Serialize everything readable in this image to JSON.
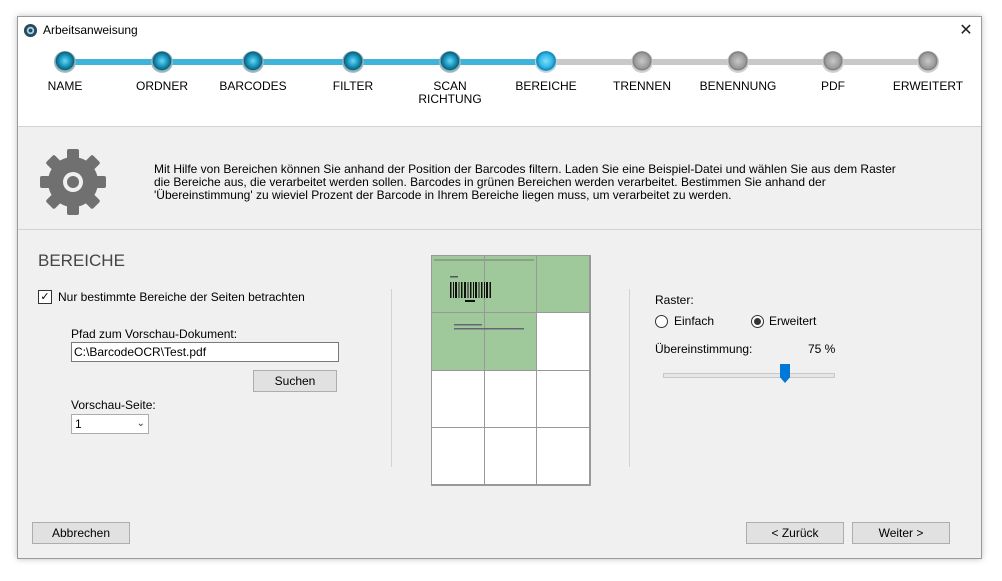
{
  "window": {
    "title": "Arbeitsanweisung",
    "close_icon": "close-icon"
  },
  "steps": [
    {
      "label": "NAME",
      "state": "done"
    },
    {
      "label": "ORDNER",
      "state": "done"
    },
    {
      "label": "BARCODES",
      "state": "done"
    },
    {
      "label": "FILTER",
      "state": "done"
    },
    {
      "label": "SCAN\nRICHTUNG",
      "state": "done"
    },
    {
      "label": "BEREICHE",
      "state": "current"
    },
    {
      "label": "TRENNEN",
      "state": "todo"
    },
    {
      "label": "BENENNUNG",
      "state": "todo"
    },
    {
      "label": "PDF",
      "state": "todo"
    },
    {
      "label": "ERWEITERT",
      "state": "todo"
    }
  ],
  "info": {
    "icon": "gear-icon",
    "text": "Mit Hilfe von Bereichen können Sie anhand der Position der Barcodes filtern. Laden Sie eine Beispiel-Datei und wählen Sie aus dem Raster die Bereiche aus, die verarbeitet werden sollen. Barcodes in grünen Bereichen werden verarbeitet. Bestimmen Sie anhand der 'Übereinstimmung' zu wieviel Prozent der Barcode in Ihrem Bereiche liegen muss, um verarbeitet zu werden."
  },
  "section": {
    "title": "BEREICHE",
    "checkbox_label": "Nur bestimmte Bereiche der Seiten betrachten",
    "checkbox_checked": true,
    "path_label": "Pfad zum Vorschau-Dokument:",
    "path_value": "C:\\BarcodeOCR\\Test.pdf",
    "search_button": "Suchen",
    "page_label": "Vorschau-Seite:",
    "page_value": "1"
  },
  "preview": {
    "grid_rows": 4,
    "grid_cols": 3,
    "selected_cells": [
      0,
      1,
      2,
      3,
      4
    ],
    "highlight_color": "#9fc89b"
  },
  "raster": {
    "label": "Raster:",
    "options": [
      {
        "label": "Einfach",
        "selected": false
      },
      {
        "label": "Erweitert",
        "selected": true
      }
    ],
    "match_label": "Übereinstimmung:",
    "match_value": "75 %",
    "match_fraction": 0.75
  },
  "footer": {
    "cancel": "Abbrechen",
    "back": "< Zurück",
    "next": "Weiter >"
  }
}
